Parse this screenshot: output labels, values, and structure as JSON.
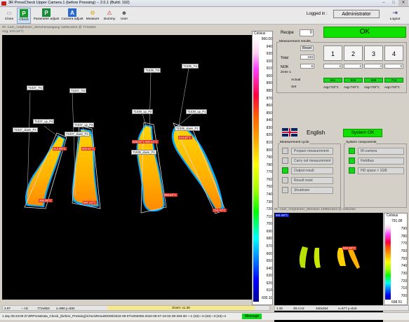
{
  "window": {
    "title": "3R PressCheck Upper Camera 1 (before Pressing) -- 2.0.1 (Build: 192)"
  },
  "toolbar": {
    "buttons": [
      {
        "label": "Close"
      },
      {
        "label": "Check"
      },
      {
        "label": "Parameter adjust"
      },
      {
        "label": "Camera adjust"
      },
      {
        "label": "Measure"
      },
      {
        "label": "Dummy"
      },
      {
        "label": "User"
      }
    ],
    "logged_in_label": "Logged in :",
    "user": "Administrator",
    "logout_label": "Logout"
  },
  "camera1": {
    "header": "IR: Cam_Vorpheizer_Strecherausgang  1288x1024 @ 772x653",
    "avg": "Avg: 570.24°C",
    "labels": [
      {
        "text": "T1037_Tr1"
      },
      {
        "text": "T1037_Tr2"
      },
      {
        "text": "T1039_Tr3"
      },
      {
        "text": "T1039_Tr4"
      },
      {
        "text": "T1037_up_P4"
      },
      {
        "text": "T1037_up_P3"
      },
      {
        "text": "T1039_up_P2"
      },
      {
        "text": "T1039_up_P1"
      },
      {
        "text": "T1037_down_P4"
      },
      {
        "text": "T1037_down_P3"
      },
      {
        "text": "T1039_down_P2"
      },
      {
        "text": "T1039_down_P1"
      }
    ],
    "temps": [
      {
        "text": "613.98°C"
      },
      {
        "text": "585.06°C"
      },
      {
        "text": "600.92°C"
      },
      {
        "text": "597.22°C"
      },
      {
        "text": "625.92°C"
      },
      {
        "text": "580.41°C"
      },
      {
        "text": "593.62°C"
      },
      {
        "text": "619.80°C"
      },
      {
        "text": "668.50°C"
      },
      {
        "text": "605.79°C"
      },
      {
        "text": "710.70°C"
      }
    ],
    "scale": {
      "header": "Celsius",
      "top": "950.03",
      "bottom": "600.11",
      "ticks": [
        "960.00",
        "940",
        "930",
        "920",
        "910",
        "900",
        "890",
        "880",
        "870",
        "860",
        "850",
        "840",
        "830",
        "820",
        "810",
        "800",
        "790",
        "780",
        "770",
        "760",
        "750",
        "740",
        "730",
        "720",
        "710",
        "700",
        "690",
        "680",
        "670",
        "660",
        "650",
        "640",
        "630",
        "620",
        "610",
        "600.11"
      ]
    },
    "status": {
      "fps": "4.97",
      "hz": "-- Hz",
      "res": "772x653",
      "coords": "x=980 y=592",
      "zoom": "Zoom: x1.36"
    }
  },
  "recipe": {
    "label": "Recipe",
    "value": "0",
    "state": "OK",
    "measurement_results_title": "Measurement results",
    "reset_label": "Reset",
    "total_label": "Total",
    "total_value": "349",
    "nok_label": "NOK",
    "nok_value": "8",
    "zones": [
      "1",
      "2",
      "3",
      "4"
    ],
    "zone_counts": [
      "0",
      "2",
      "4",
      "0"
    ],
    "zone1_label": "Zone 1",
    "actual_label": "Actual",
    "set_label": "Set",
    "actual_values": [
      "611",
      "622",
      "625",
      "714"
    ],
    "set_values": [
      "Avg<720°C",
      "Avg<720°C",
      "Avg<720°C",
      "Avg<720°C"
    ]
  },
  "language": {
    "label": "English",
    "system_state": "System OK"
  },
  "measurement_cycle": {
    "title": "Measurement cycle",
    "items": [
      {
        "label": "Prepare measurement",
        "on": false
      },
      {
        "label": "Carry out measurement",
        "on": false
      },
      {
        "label": "Output result",
        "on": true
      },
      {
        "label": "Result reset",
        "on": false
      },
      {
        "label": "Shutdown",
        "on": false
      }
    ]
  },
  "system_components": {
    "title": "System components",
    "items": [
      {
        "label": "IR-camera"
      },
      {
        "label": "Fieldbus"
      },
      {
        "label": "HD space > 1GB"
      }
    ]
  },
  "camera2": {
    "header": "IR: Cam_Vorpheizer_Strecken  1288x1024 @ 340x264",
    "temp": "591.58°C",
    "temp2": "693.38°C",
    "scale": {
      "header": "Celsius",
      "top": "791.08",
      "bottom": "698.51",
      "ticks": [
        "790",
        "780",
        "770",
        "760",
        "750",
        "740",
        "730",
        "720",
        "710",
        "700"
      ]
    },
    "status": {
      "fps": "1.32",
      "hz": "29.4 Hz",
      "res": "340x264",
      "coords": "x=677 y=616"
    }
  },
  "path": {
    "text": "1 day 08:43:09   D:\\3RPressData_Check_(before_Pressing)\\CheckResults\\006\\2016-09-07\\1092006-2016-09-07-19-02-39-349-30-~-1-(33)~-2-(33)~-3-(33)~4",
    "message": "Message"
  }
}
